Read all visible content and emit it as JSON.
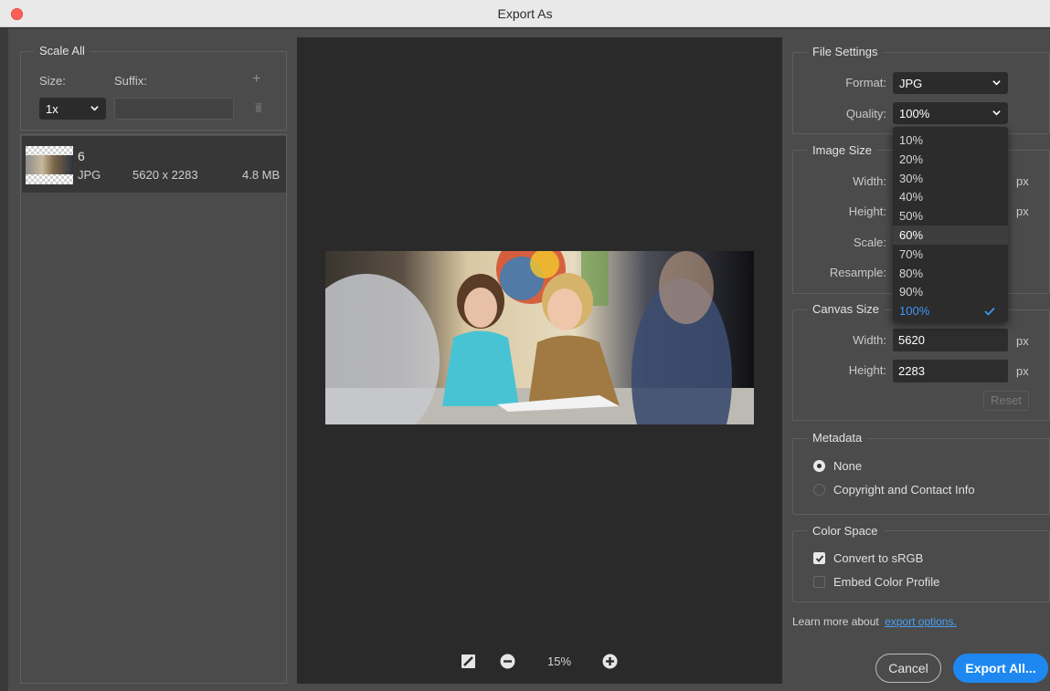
{
  "window": {
    "title": "Export As"
  },
  "scale_all": {
    "legend": "Scale All",
    "size_label": "Size:",
    "suffix_label": "Suffix:",
    "size_value": "1x",
    "suffix_value": "",
    "add_icon": "plus-icon",
    "delete_icon": "trash-icon"
  },
  "asset": {
    "name": "6",
    "format": "JPG",
    "dimensions": "5620 x 2283",
    "filesize": "4.8 MB"
  },
  "preview": {
    "zoom": "15%"
  },
  "file_settings": {
    "legend": "File Settings",
    "format_label": "Format:",
    "format_value": "JPG",
    "quality_label": "Quality:",
    "quality_value": "100%",
    "quality_options": [
      "10%",
      "20%",
      "30%",
      "40%",
      "50%",
      "60%",
      "70%",
      "80%",
      "90%",
      "100%"
    ],
    "quality_hovered": "60%",
    "quality_selected": "100%"
  },
  "image_size": {
    "legend": "Image Size",
    "width_label": "Width:",
    "height_label": "Height:",
    "scale_label": "Scale:",
    "resample_label": "Resample:",
    "unit": "px"
  },
  "canvas_size": {
    "legend": "Canvas Size",
    "width_label": "Width:",
    "width_value": "5620",
    "height_label": "Height:",
    "height_value": "2283",
    "unit": "px",
    "reset_label": "Reset"
  },
  "metadata": {
    "legend": "Metadata",
    "option_none": "None",
    "option_copyright": "Copyright and Contact Info",
    "selected": "None"
  },
  "color_space": {
    "legend": "Color Space",
    "convert_label": "Convert to sRGB",
    "convert_checked": true,
    "embed_label": "Embed Color Profile",
    "embed_checked": false
  },
  "footer": {
    "learn_more": "Learn more about",
    "learn_link": "export options.",
    "cancel_label": "Cancel",
    "export_label": "Export All..."
  },
  "colors": {
    "accent": "#1e88f0",
    "panel": "#4b4b4b",
    "preview_bg": "#2a2a2a"
  }
}
